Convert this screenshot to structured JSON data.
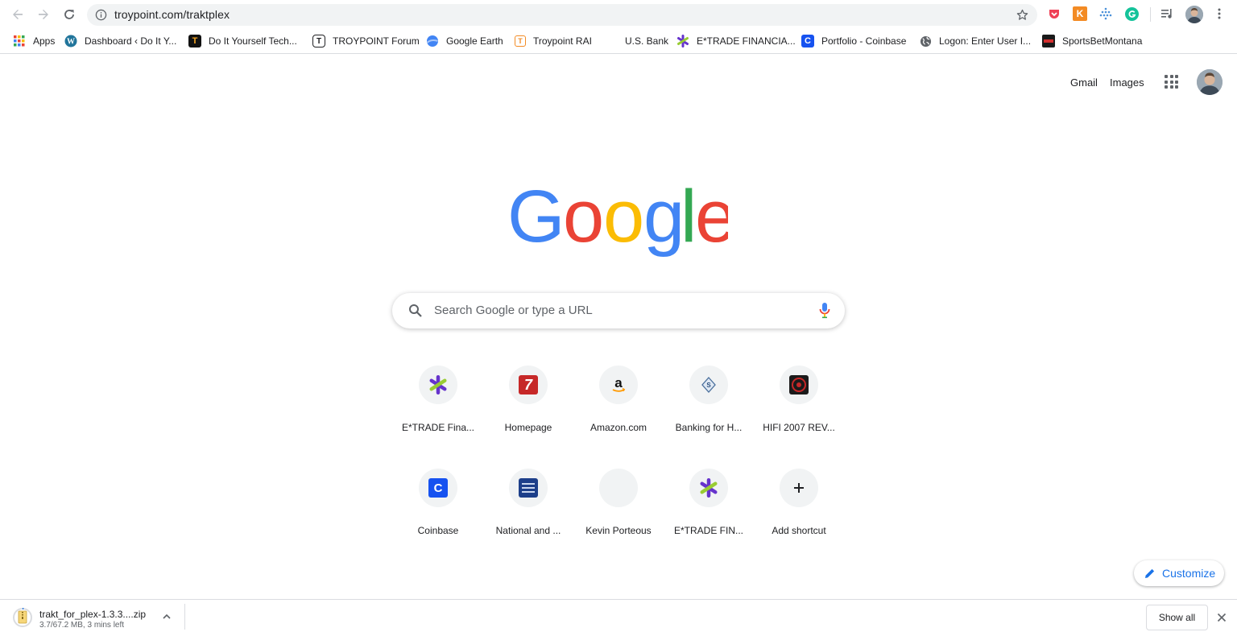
{
  "toolbar": {
    "url": "troypoint.com/traktplex",
    "icons": [
      "back-icon",
      "forward-icon",
      "reload-icon",
      "info-icon",
      "star-icon"
    ],
    "extensions": [
      "pocket-icon",
      "k-extension-icon",
      "dots-extension-icon",
      "grammarly-icon",
      "media-controls-icon",
      "profile-avatar",
      "menu-icon"
    ]
  },
  "bookmarks": [
    {
      "label": "Apps",
      "icon": "apps-grid-icon"
    },
    {
      "label": "Dashboard ‹ Do It Y...",
      "icon": "wordpress-icon"
    },
    {
      "label": "Do It Yourself Tech...",
      "icon": "troypoint-t-icon"
    },
    {
      "label": "TROYPOINT Forum",
      "icon": "troypoint-forum-icon"
    },
    {
      "label": "Google Earth",
      "icon": "google-earth-icon"
    },
    {
      "label": "Troypoint RAI",
      "icon": "troypoint-rai-icon"
    },
    {
      "label": "U.S. Bank",
      "icon": ""
    },
    {
      "label": "E*TRADE FINANCIA...",
      "icon": "etrade-icon"
    },
    {
      "label": "Portfolio - Coinbase",
      "icon": "coinbase-icon"
    },
    {
      "label": "Logon: Enter User I...",
      "icon": "globe-icon"
    },
    {
      "label": "SportsBetMontana",
      "icon": "sportsbet-icon"
    }
  ],
  "ntp": {
    "gmail_label": "Gmail",
    "images_label": "Images",
    "search_placeholder": "Search Google or type a URL",
    "tiles": [
      {
        "title": "E*TRADE Fina...",
        "icon": "etrade-icon"
      },
      {
        "title": "Homepage",
        "icon": "seven-icon"
      },
      {
        "title": "Amazon.com",
        "icon": "amazon-icon"
      },
      {
        "title": "Banking for H...",
        "icon": "bank-icon"
      },
      {
        "title": "HIFI 2007 REV...",
        "icon": "hifi-icon"
      },
      {
        "title": "Coinbase",
        "icon": "coinbase-icon"
      },
      {
        "title": "National and ...",
        "icon": "weather-channel-icon"
      },
      {
        "title": "Kevin Porteous",
        "icon": ""
      },
      {
        "title": "E*TRADE FIN...",
        "icon": "etrade-icon"
      },
      {
        "title": "Add shortcut",
        "icon": "plus-icon"
      }
    ],
    "customize_label": "Customize"
  },
  "downloads": {
    "filename": "trakt_for_plex-1.3.3....zip",
    "status": "3.7/67.2 MB, 3 mins left",
    "show_all_label": "Show all"
  },
  "colors": {
    "google_blue": "#4285f4",
    "google_red": "#ea4335",
    "google_yellow": "#fbbc05",
    "google_green": "#34a853",
    "accent": "#1a73e8",
    "etrade_purple": "#6633cc",
    "etrade_green": "#99cc33"
  }
}
